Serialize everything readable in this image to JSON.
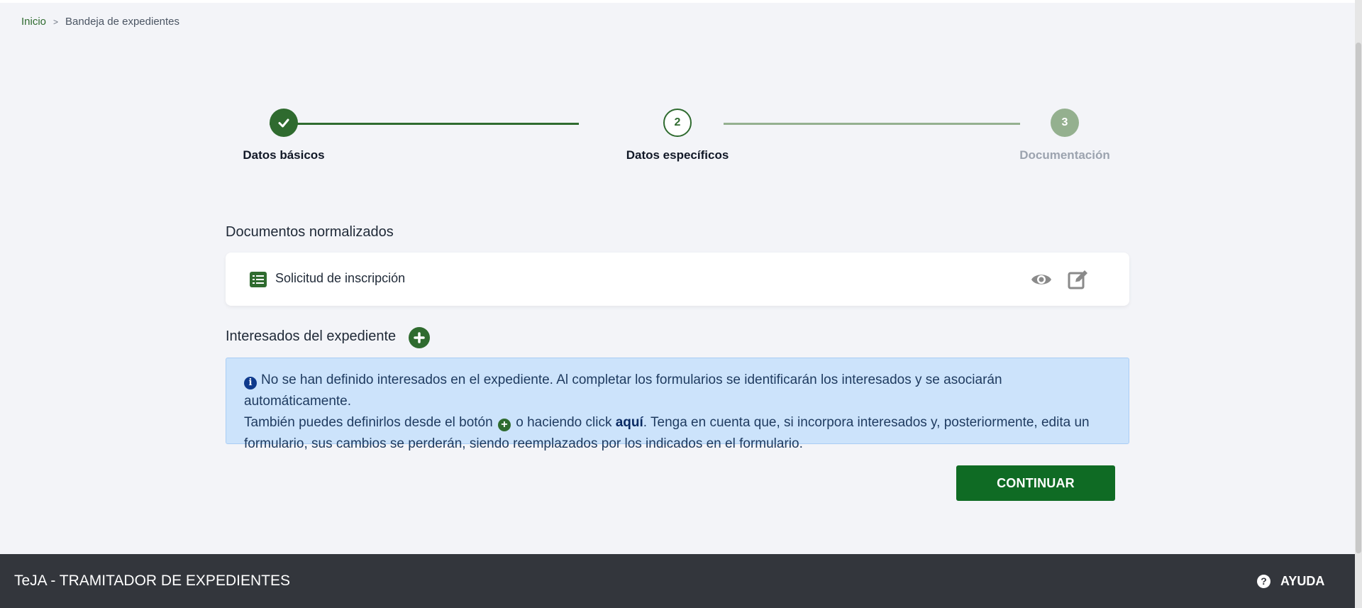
{
  "breadcrumb": {
    "home": "Inicio",
    "separator": ">",
    "current": "Bandeja de expedientes"
  },
  "stepper": {
    "steps": [
      {
        "number": "",
        "label": "Datos básicos",
        "status": "completed"
      },
      {
        "number": "2",
        "label": "Datos específicos",
        "status": "active"
      },
      {
        "number": "3",
        "label": "Documentación",
        "status": "pending"
      }
    ]
  },
  "documents": {
    "title": "Documentos normalizados",
    "items": [
      {
        "name": "Solicitud de inscripción",
        "icon": "list-alt-icon"
      }
    ]
  },
  "interested": {
    "title": "Interesados del expediente",
    "info": {
      "line1": "No se han definido interesados en el expediente. Al completar los formularios se identificarán los interesados y se asociarán automáticamente.",
      "line2a": "También puedes definirlos desde el botón",
      "line2b": "o haciendo click",
      "link": "aquí",
      "line2c": ". Tenga en cuenta que, si incorpora interesados y, posteriormente, edita un formulario, sus cambios se perderán, siendo reemplazados por los indicados en el formulario."
    }
  },
  "actions": {
    "continue": "CONTINUAR"
  },
  "footer": {
    "app_name": "TeJA - TRAMITADOR DE EXPEDIENTES",
    "help": "AYUDA"
  },
  "colors": {
    "primary": "#2f6b2f",
    "button": "#0f6b24",
    "info_bg": "#cce3fb",
    "footer_bg": "#33363c"
  }
}
